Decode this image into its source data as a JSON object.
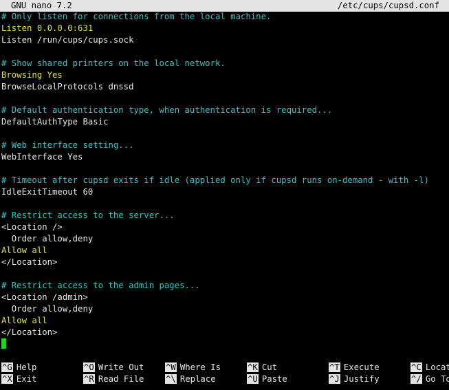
{
  "titlebar": {
    "app": "GNU nano 7.2",
    "file": "/etc/cups/cupsd.conf"
  },
  "lines": [
    {
      "text": "# Only listen for connections from the local machine.",
      "kind": "comment"
    },
    {
      "text": "Listen 0.0.0.0:631",
      "kind": "keyword"
    },
    {
      "text": "Listen /run/cups/cups.sock",
      "kind": "directive"
    },
    {
      "text": "",
      "kind": "directive"
    },
    {
      "text": "# Show shared printers on the local network.",
      "kind": "comment"
    },
    {
      "text": "Browsing Yes",
      "kind": "keyword"
    },
    {
      "text": "BrowseLocalProtocols dnssd",
      "kind": "directive"
    },
    {
      "text": "",
      "kind": "directive"
    },
    {
      "text": "# Default authentication type, when authentication is required...",
      "kind": "comment"
    },
    {
      "text": "DefaultAuthType Basic",
      "kind": "directive"
    },
    {
      "text": "",
      "kind": "directive"
    },
    {
      "text": "# Web interface setting...",
      "kind": "comment"
    },
    {
      "text": "WebInterface Yes",
      "kind": "directive"
    },
    {
      "text": "",
      "kind": "directive"
    },
    {
      "text": "# Timeout after cupsd exits if idle (applied only if cupsd runs on-demand - with -l)",
      "kind": "comment"
    },
    {
      "text": "IdleExitTimeout 60",
      "kind": "directive"
    },
    {
      "text": "",
      "kind": "directive"
    },
    {
      "text": "# Restrict access to the server...",
      "kind": "comment"
    },
    {
      "text": "<Location />",
      "kind": "directive"
    },
    {
      "text": "  Order allow,deny",
      "kind": "directive"
    },
    {
      "text": "Allow all",
      "kind": "keyword"
    },
    {
      "text": "</Location>",
      "kind": "directive"
    },
    {
      "text": "",
      "kind": "directive"
    },
    {
      "text": "# Restrict access to the admin pages...",
      "kind": "comment"
    },
    {
      "text": "<Location /admin>",
      "kind": "directive"
    },
    {
      "text": "  Order allow,deny",
      "kind": "directive"
    },
    {
      "text": "Allow all",
      "kind": "keyword"
    },
    {
      "text": "</Location>",
      "kind": "directive"
    },
    {
      "text": "",
      "kind": "cursor"
    }
  ],
  "shortcuts": {
    "row1": [
      {
        "key": "^G",
        "label": "Help"
      },
      {
        "key": "^O",
        "label": "Write Out"
      },
      {
        "key": "^W",
        "label": "Where Is"
      },
      {
        "key": "^K",
        "label": "Cut"
      },
      {
        "key": "^T",
        "label": "Execute"
      },
      {
        "key": "^C",
        "label": "Location"
      }
    ],
    "row2": [
      {
        "key": "^X",
        "label": "Exit"
      },
      {
        "key": "^R",
        "label": "Read File"
      },
      {
        "key": "^\\",
        "label": "Replace"
      },
      {
        "key": "^U",
        "label": "Paste"
      },
      {
        "key": "^J",
        "label": "Justify"
      },
      {
        "key": "^/",
        "label": "Go To Line"
      }
    ]
  },
  "colors": {
    "comment": "#2fc7c7",
    "keyword": "#e3e33d",
    "cursor": "#20d620",
    "bar": "#e4e4e4"
  }
}
